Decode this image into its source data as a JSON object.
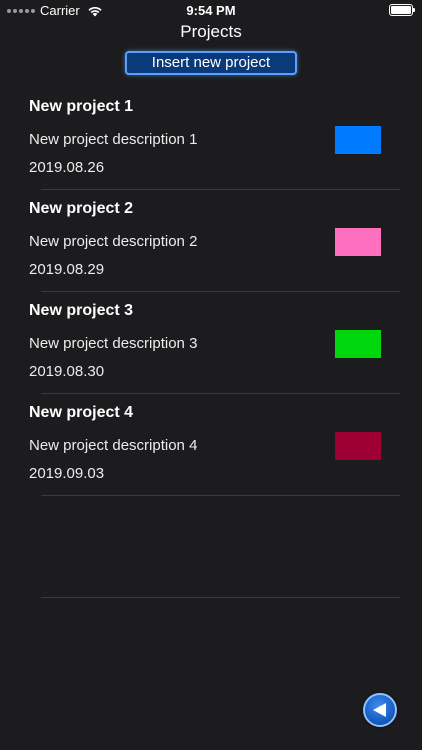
{
  "status_bar": {
    "carrier": "Carrier",
    "time": "9:54 PM"
  },
  "nav": {
    "title": "Projects"
  },
  "actions": {
    "insert_label": "Insert new project"
  },
  "projects": [
    {
      "title": "New project 1",
      "description": "New project description 1",
      "date": "2019.08.26",
      "color": "#007aff"
    },
    {
      "title": "New project 2",
      "description": "New project description 2",
      "date": "2019.08.29",
      "color": "#ff6fbf"
    },
    {
      "title": "New project 3",
      "description": "New project description 3",
      "date": "2019.08.30",
      "color": "#00d70c"
    },
    {
      "title": "New project 4",
      "description": "New project description 4",
      "date": "2019.09.03",
      "color": "#9e0033"
    }
  ],
  "icons": {
    "wifi": "wifi-icon",
    "battery": "battery-icon",
    "back": "back-arrow-icon"
  }
}
